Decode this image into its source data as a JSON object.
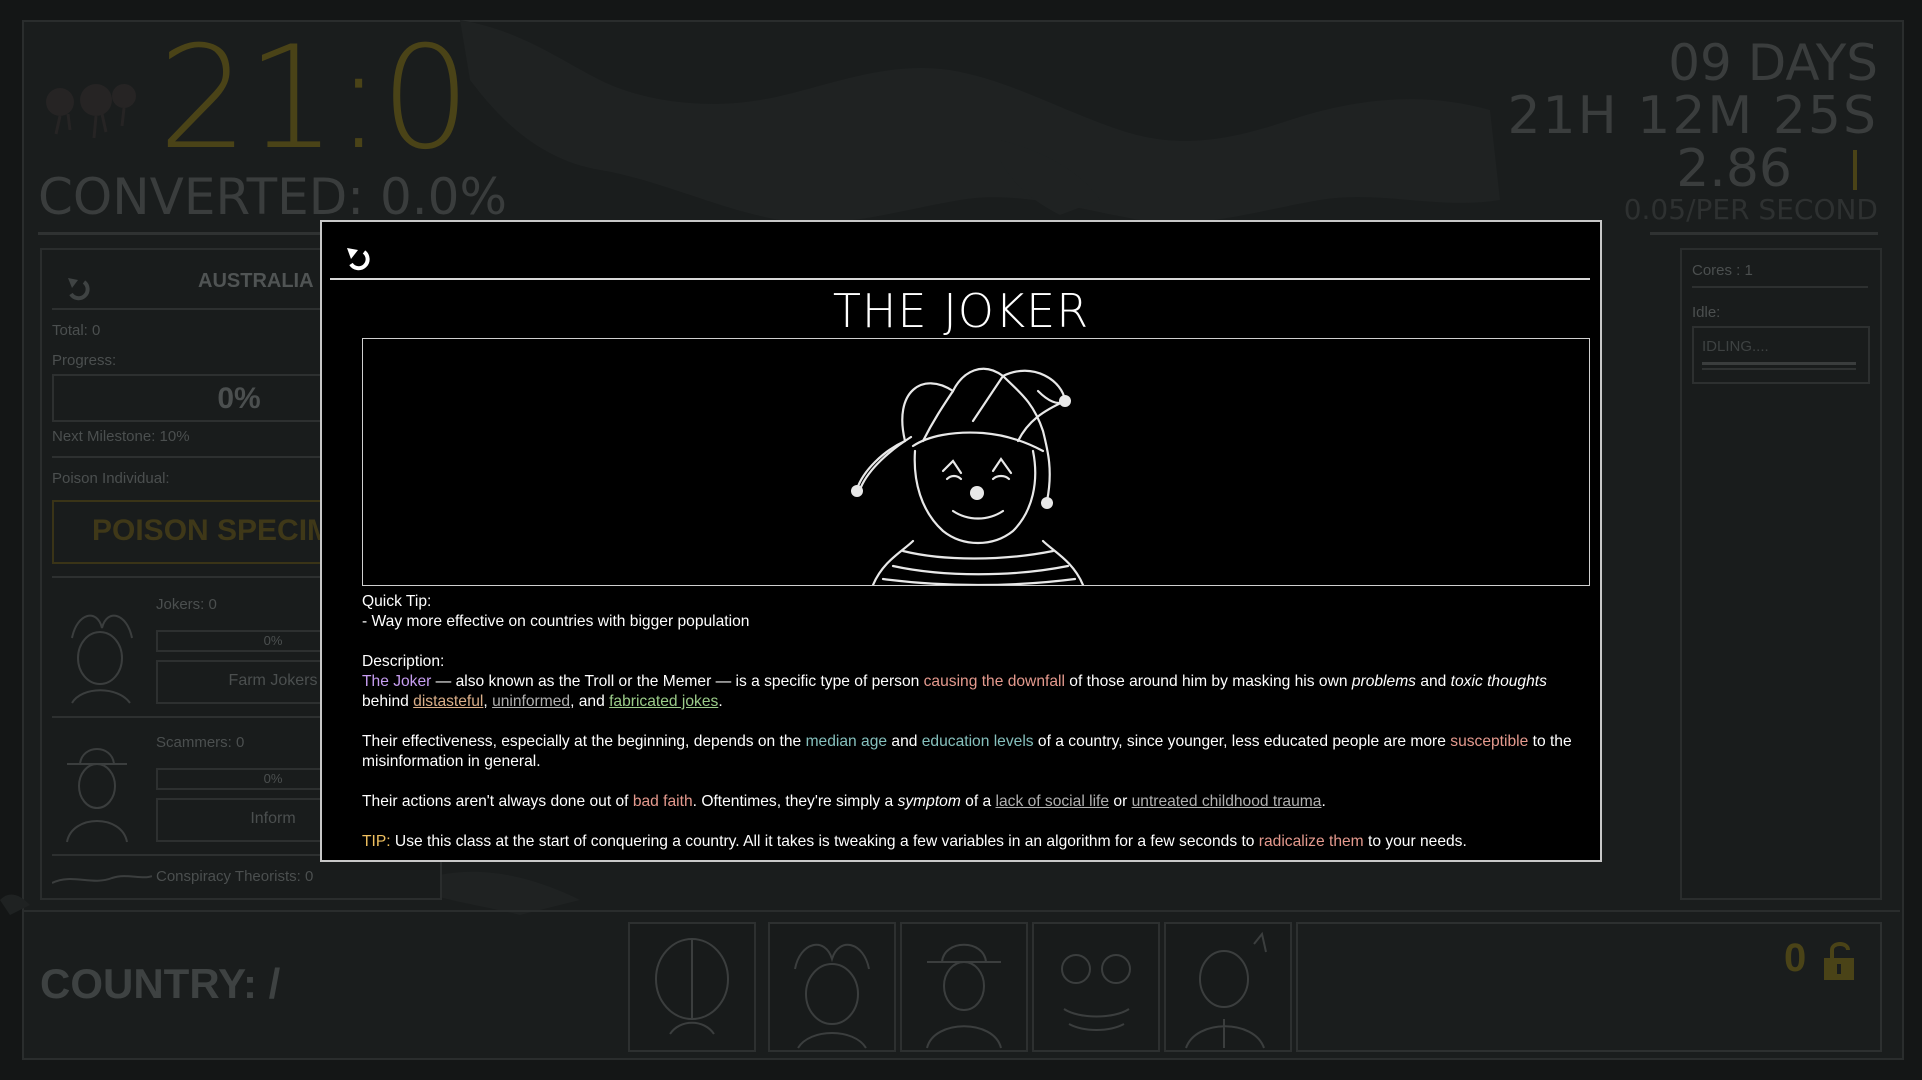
{
  "hud": {
    "clock": "21:0",
    "converted": "CONVERTED: 0.0%",
    "days": "09 DAYS",
    "hms": "21H 12M 25S",
    "rate": "2.86",
    "per_second": "0.05/PER SECOND"
  },
  "left_panel": {
    "country": "AUSTRALIA",
    "total": "Total: 0",
    "progress_label": "Progress:",
    "progress_value": "0%",
    "next_milestone": "Next Milestone: 10%",
    "poison_label": "Poison Individual:",
    "poison_button": "POISON SPECIMEN",
    "units": [
      {
        "name": "Jokers: 0",
        "progress": "0%",
        "button": "Farm Jokers"
      },
      {
        "name": "Scammers: 0",
        "progress": "0%",
        "button": "Inform"
      },
      {
        "name": "Conspiracy Theorists: 0"
      }
    ]
  },
  "right_panel": {
    "cores": "Cores :  1",
    "idle_label": "Idle:",
    "idle_status": "IDLING...."
  },
  "bottom": {
    "country": "COUNTRY: /",
    "count": "0"
  },
  "modal": {
    "title": "THE JOKER",
    "quick_tip_label": "Quick Tip:",
    "quick_tip": "- Way more effective on countries with bigger population",
    "description_label": "Description:",
    "p1": {
      "name": "The Joker",
      "a": " — also known as the Troll or the Memer — is a specific type of person ",
      "downfall": "causing the downfall",
      "b": " of those around him by masking his own ",
      "problems": "problems",
      "and": " and ",
      "toxic": "toxic thoughts",
      "behind": " behind ",
      "distasteful": "distasteful",
      "comma": ", ",
      "uninformed": "uninformed",
      "and2": ", and ",
      "fabricated": "fabricated jokes",
      "end": "."
    },
    "p2": {
      "a": "Their effectiveness, especially at the beginning, depends on the ",
      "median": "median age",
      "and": " and ",
      "education": "education levels",
      "b": " of a country, since younger, less educated people are more ",
      "susceptible": "susceptible",
      "c": " to the misinformation in general."
    },
    "p3": {
      "a": "Their actions aren't always done out of ",
      "bad_faith": "bad faith",
      "b": ". Oftentimes, they're simply a ",
      "symptom": "symptom",
      "c": " of a ",
      "lack": "lack of social life",
      "or": " or ",
      "trauma": "untreated childhood trauma",
      "end": "."
    },
    "p4": {
      "tip": "TIP:",
      "a": " Use this class at the start of conquering a country. All it takes is tweaking a few variables in an algorithm for a few seconds to ",
      "radicalize": "radicalize them",
      "b": " to your needs."
    }
  }
}
